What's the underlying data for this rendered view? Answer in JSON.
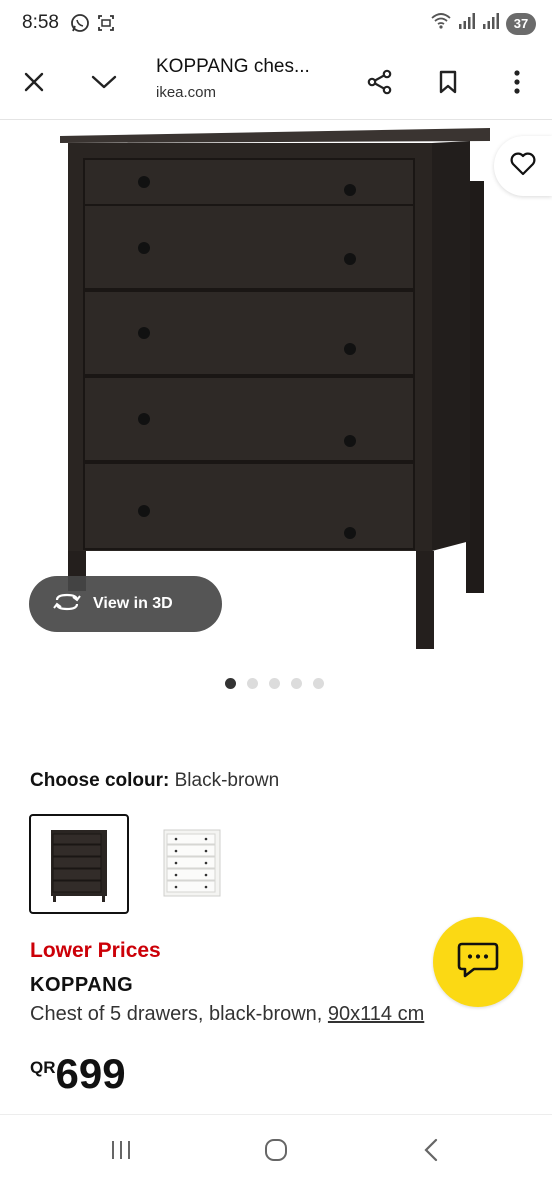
{
  "status": {
    "time": "8:58",
    "battery": "37",
    "left_icons": [
      "whatsapp-icon",
      "screenshot-icon"
    ],
    "right_icons": [
      "wifi-icon",
      "signal-icon",
      "signal-icon"
    ]
  },
  "toolbar": {
    "title": "KOPPANG ches...",
    "url": "ikea.com",
    "icons": [
      "close-icon",
      "chevron-down-icon",
      "share-icon",
      "bookmark-icon",
      "more-vert-icon"
    ]
  },
  "gallery": {
    "view_3d_label": "View in 3D",
    "image_count": 5,
    "active_index": 0
  },
  "colour": {
    "label": "Choose colour:",
    "selected": "Black-brown",
    "options": [
      "Black-brown",
      "White"
    ]
  },
  "product": {
    "promo": "Lower Prices",
    "name": "KOPPANG",
    "description": "Chest of 5 drawers, black-brown,",
    "dimensions": "90x114 cm",
    "currency": "QR",
    "price": "699"
  },
  "colors": {
    "promo_red": "#cc0008",
    "chat_yellow": "#fbd914",
    "furniture": "#2a2522"
  },
  "navbar": {
    "icons": [
      "recent-apps-icon",
      "home-icon",
      "back-icon"
    ]
  }
}
